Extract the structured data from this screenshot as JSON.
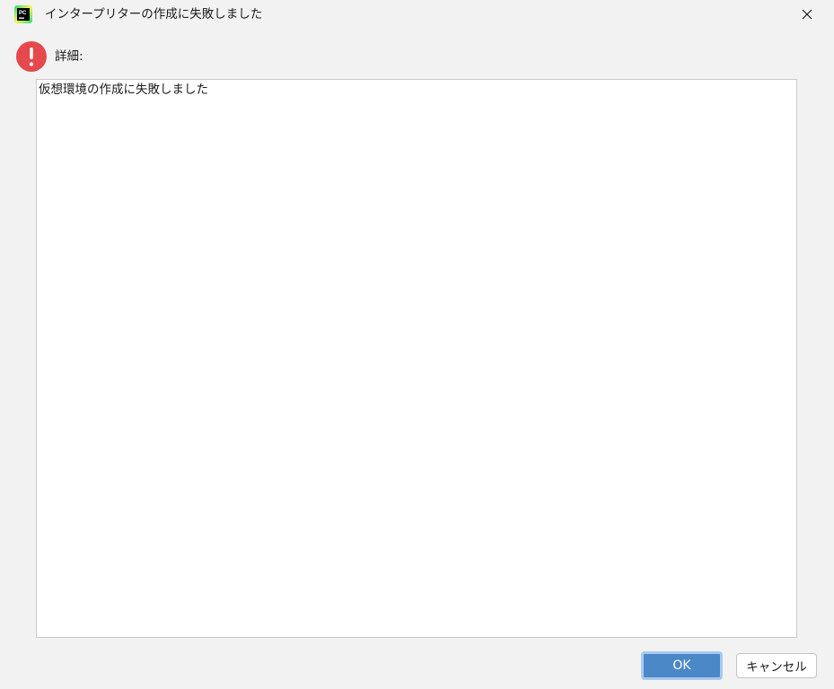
{
  "window": {
    "title": "インタープリターの作成に失敗しました",
    "app_icon": "pycharm-icon",
    "app_icon_text": "PC",
    "close_icon": "close-icon"
  },
  "details": {
    "icon": "error-icon",
    "label": "詳細:",
    "message": "仮想環境の作成に失敗しました"
  },
  "buttons": {
    "ok_label": "OK",
    "cancel_label": "キャンセル"
  },
  "colors": {
    "background": "#f2f2f2",
    "error_red": "#e5484d",
    "primary_button": "#4a88c7",
    "primary_button_focus": "#a9c9ef"
  }
}
